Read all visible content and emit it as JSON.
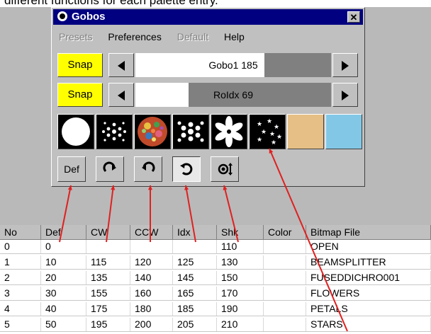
{
  "caption_text": "different functions for each palette entry.",
  "window": {
    "title": "Gobos",
    "close_glyph": "✕"
  },
  "menu": [
    {
      "label": "Presets",
      "disabled": true
    },
    {
      "label": "Preferences",
      "disabled": false
    },
    {
      "label": "Default",
      "disabled": true
    },
    {
      "label": "Help",
      "disabled": false
    }
  ],
  "rows": [
    {
      "snap_label": "Snap",
      "slider_label": "Gobo1 185",
      "fill_fraction": 0.66
    },
    {
      "snap_label": "Snap",
      "slider_label": "RoIdx 69",
      "fill_fraction": 0.27
    }
  ],
  "swatches": [
    {
      "name": "open-gobo",
      "kind": "open"
    },
    {
      "name": "beamsplitter-gobo",
      "kind": "beamsplitter"
    },
    {
      "name": "fuseddichro-gobo",
      "kind": "dichro"
    },
    {
      "name": "flowers-gobo",
      "kind": "flowers"
    },
    {
      "name": "petals-gobo",
      "kind": "petals"
    },
    {
      "name": "stars-gobo",
      "kind": "stars"
    },
    {
      "name": "tan-color-swatch",
      "kind": "color",
      "color": "#e6bf86"
    },
    {
      "name": "blue-color-swatch",
      "kind": "color",
      "color": "#82c8e6"
    }
  ],
  "tools": [
    {
      "name": "def-button",
      "label": "Def",
      "icon": ""
    },
    {
      "name": "cw-button",
      "label": "",
      "icon": "rotate-cw-icon"
    },
    {
      "name": "ccw-button",
      "label": "",
      "icon": "rotate-ccw-icon"
    },
    {
      "name": "idx-button",
      "label": "",
      "icon": "index-icon",
      "pressed": true
    },
    {
      "name": "shake-button",
      "label": "",
      "icon": "shake-icon"
    }
  ],
  "table": {
    "headers": [
      "No",
      "Def",
      "CW",
      "CCW",
      "Idx",
      "Shk",
      "Color",
      "Bitmap File"
    ],
    "rows": [
      [
        "0",
        "0",
        "",
        "",
        "",
        "110",
        "",
        "OPEN"
      ],
      [
        "1",
        "10",
        "115",
        "120",
        "125",
        "130",
        "",
        "BEAMSPLITTER"
      ],
      [
        "2",
        "20",
        "135",
        "140",
        "145",
        "150",
        "",
        "FUSEDDICHRO001"
      ],
      [
        "3",
        "30",
        "155",
        "160",
        "165",
        "170",
        "",
        "FLOWERS"
      ],
      [
        "4",
        "40",
        "175",
        "180",
        "185",
        "190",
        "",
        "PETALS"
      ],
      [
        "5",
        "50",
        "195",
        "200",
        "205",
        "210",
        "",
        "STARS"
      ]
    ]
  },
  "colors": {
    "accent_arrow": "#e02020",
    "snap_yellow": "#ffff00",
    "titlebar": "#000080"
  }
}
